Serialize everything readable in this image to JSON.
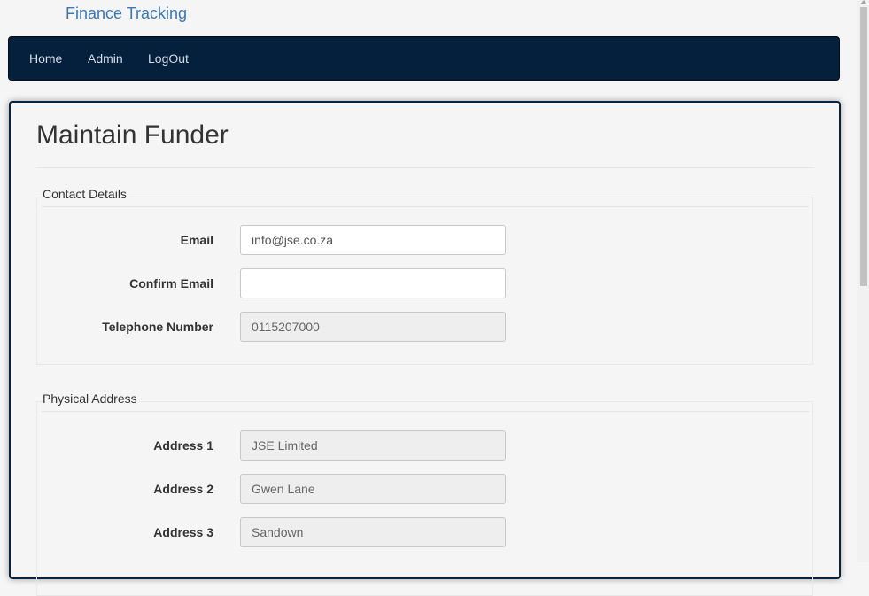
{
  "app": {
    "brand": "Finance Tracking"
  },
  "nav": {
    "items": [
      {
        "label": "Home"
      },
      {
        "label": "Admin"
      },
      {
        "label": "LogOut"
      }
    ]
  },
  "page": {
    "title": "Maintain Funder"
  },
  "contact_details": {
    "legend": "Contact Details",
    "email": {
      "label": "Email",
      "value": "info@jse.co.za"
    },
    "confirm_email": {
      "label": "Confirm Email",
      "value": ""
    },
    "telephone": {
      "label": "Telephone Number",
      "value": "0115207000"
    }
  },
  "physical_address": {
    "legend": "Physical Address",
    "address1": {
      "label": "Address 1",
      "value": "JSE Limited"
    },
    "address2": {
      "label": "Address 2",
      "value": "Gwen Lane"
    },
    "address3": {
      "label": "Address 3",
      "value": "Sandown"
    }
  },
  "colors": {
    "navbar": "#04203d",
    "brand": "#3a78b5",
    "panel_border": "#0b2340"
  }
}
